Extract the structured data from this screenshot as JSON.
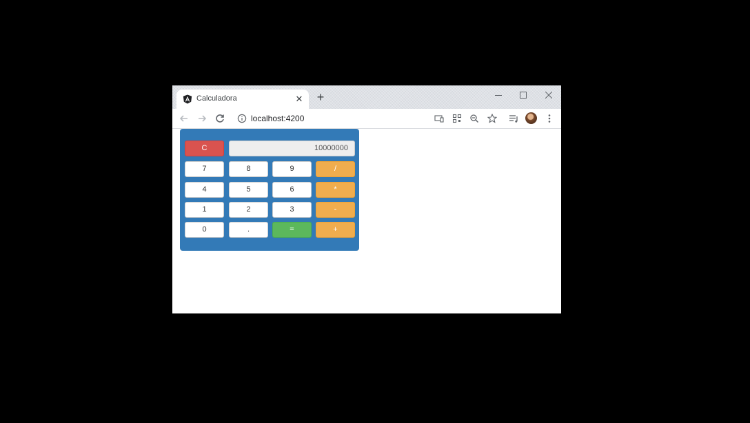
{
  "tab": {
    "title": "Calculadora"
  },
  "omnibox": {
    "url": "localhost:4200"
  },
  "calculator": {
    "display": "10000000",
    "clear": "C",
    "rows": [
      [
        "7",
        "8",
        "9",
        "/"
      ],
      [
        "4",
        "5",
        "6",
        "*"
      ],
      [
        "1",
        "2",
        "3",
        "-"
      ],
      [
        "0",
        ".",
        "=",
        "+"
      ]
    ]
  },
  "colors": {
    "panel": "#337ab7",
    "danger": "#d9534f",
    "warning": "#f0ad4e",
    "success": "#5cb85c"
  },
  "icons": [
    "angular-favicon",
    "close-icon",
    "new-tab-icon",
    "minimize-icon",
    "maximize-icon",
    "window-close-icon",
    "back-icon",
    "forward-icon",
    "reload-icon",
    "info-icon",
    "cast-icon",
    "qr-code-icon",
    "zoom-icon",
    "star-icon",
    "media-queue-icon",
    "avatar",
    "more-menu-icon"
  ]
}
